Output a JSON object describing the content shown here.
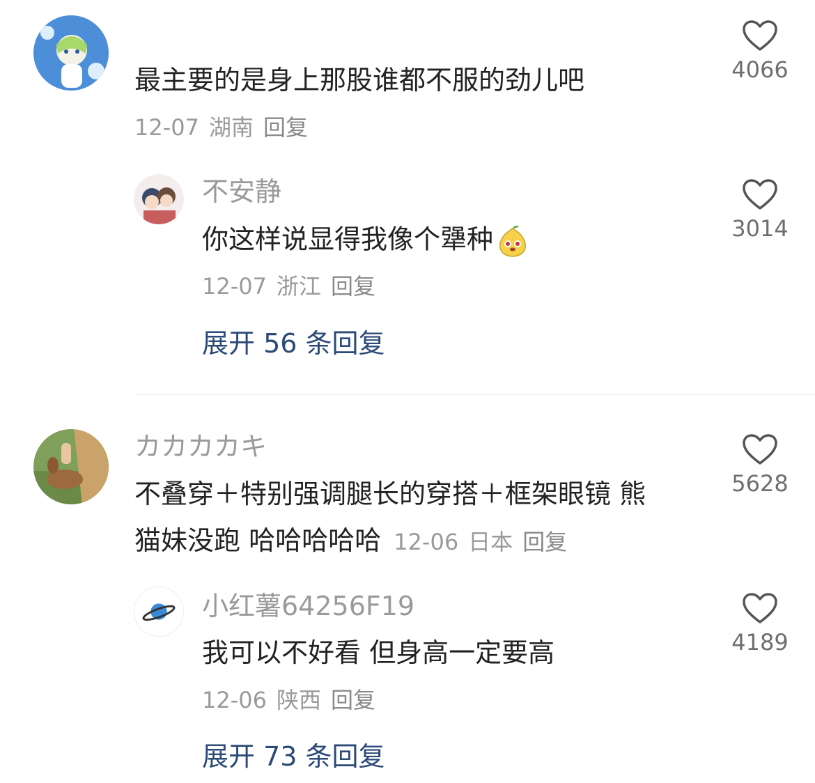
{
  "comments": [
    {
      "text": "最主要的是身上那股谁都不服的劲儿吧",
      "date": "12-07",
      "location": "湖南",
      "reply_label": "回复",
      "likes": "4066",
      "replies": [
        {
          "username": "不安静",
          "text": "你这样说显得我像个犟种",
          "date": "12-07",
          "location": "浙江",
          "reply_label": "回复",
          "likes": "3014"
        }
      ],
      "expand_label": "展开 56 条回复"
    },
    {
      "username": "カカカカキ",
      "text_line1": "不叠穿＋特别强调腿长的穿搭＋框架眼镜 熊",
      "text_line2": "猫妹没跑 哈哈哈哈哈",
      "date": "12-06",
      "location": "日本",
      "reply_label": "回复",
      "likes": "5628",
      "replies": [
        {
          "username": "小红薯64256F19",
          "text": "我可以不好看 但身高一定要高",
          "date": "12-06",
          "location": "陕西",
          "reply_label": "回复",
          "likes": "4189"
        }
      ],
      "expand_label": "展开 73 条回复"
    }
  ],
  "icons": {
    "like": "heart-outline-icon",
    "emoji": "pear-face-emoji"
  },
  "colors": {
    "text": "#222222",
    "muted": "#9a9a9a",
    "link": "#2b4a78"
  }
}
